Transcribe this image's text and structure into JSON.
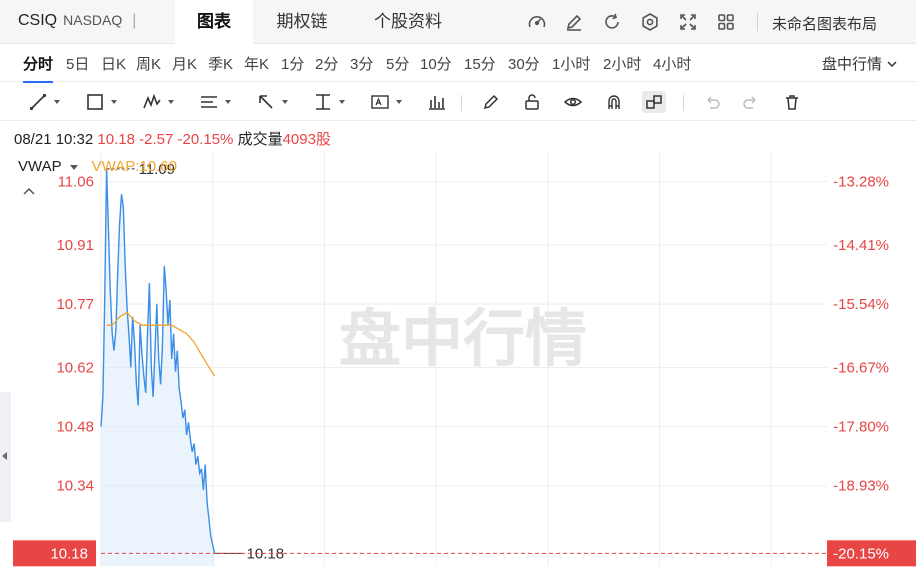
{
  "header": {
    "symbol": "CSIQ",
    "exchange": "NASDAQ",
    "separator": "|",
    "tabs": [
      {
        "label": "图表",
        "active": true
      },
      {
        "label": "期权链",
        "active": false
      },
      {
        "label": "个股资料",
        "active": false
      }
    ],
    "icons": [
      "speedometer-icon",
      "edit-icon",
      "refresh-icon",
      "settings-icon",
      "fullscreen-icon",
      "layout-grid-icon"
    ],
    "layout_name": "未命名图表布局"
  },
  "intervals": {
    "items": [
      "分时",
      "5日",
      "日K",
      "周K",
      "月K",
      "季K",
      "年K",
      "1分",
      "2分",
      "3分",
      "5分",
      "10分",
      "15分",
      "30分",
      "1小时",
      "2小时",
      "4小时"
    ],
    "active": "分时",
    "session_label": "盘中行情"
  },
  "quote": {
    "datetime": "08/21 10:32",
    "price": "10.18",
    "change": "-2.57",
    "change_pct": "-20.15%",
    "volume_label": "成交量",
    "volume": "4093股"
  },
  "indicator": {
    "name": "VWAP",
    "value_label": "VWAP:10.60"
  },
  "colors": {
    "price_line": "#3a8ee6",
    "price_fill": "#dbeafb",
    "vwap_line": "#f0a42a",
    "down_red": "#e84545",
    "grid": "#eeeeee",
    "watermark": "#e6e6e6"
  },
  "chart_data": {
    "type": "line",
    "watermark": "盘中行情",
    "ylim": [
      10.15,
      11.13
    ],
    "yticks": [
      "11.06",
      "10.91",
      "10.77",
      "10.62",
      "10.48",
      "10.34"
    ],
    "pct_ticks": [
      "-13.28%",
      "-14.41%",
      "-15.54%",
      "-16.67%",
      "-17.80%",
      "-18.93%"
    ],
    "high_label": "11.09",
    "low_label": "10.18",
    "last_price_label": "10.18",
    "last_pct_label": "-20.15%",
    "session_minutes": 390,
    "series": [
      {
        "name": "",
        "role": "price",
        "minutes": [
          0,
          1,
          2,
          3,
          4,
          5,
          6,
          7,
          8,
          9,
          10,
          11,
          12,
          13,
          14,
          15,
          16,
          17,
          18,
          19,
          20,
          21,
          22,
          23,
          24,
          25,
          26,
          27,
          28,
          29,
          30,
          31,
          32,
          33,
          34,
          35,
          36,
          37,
          38,
          39,
          40,
          41,
          42,
          43,
          44,
          45,
          46,
          47,
          48,
          49,
          50,
          51,
          52,
          53,
          54,
          55,
          56,
          57,
          58,
          59,
          60,
          61
        ],
        "values": [
          10.48,
          10.55,
          10.78,
          11.09,
          10.95,
          10.8,
          10.7,
          10.66,
          10.71,
          10.85,
          10.96,
          11.03,
          11.0,
          10.86,
          10.76,
          10.7,
          10.62,
          10.74,
          10.68,
          10.58,
          10.53,
          10.72,
          10.65,
          10.6,
          10.56,
          10.7,
          10.82,
          10.62,
          10.55,
          10.66,
          10.77,
          10.64,
          10.58,
          10.67,
          10.86,
          10.8,
          10.72,
          10.78,
          10.64,
          10.7,
          10.61,
          10.66,
          10.57,
          10.54,
          10.5,
          10.52,
          10.46,
          10.49,
          10.45,
          10.42,
          10.44,
          10.39,
          10.41,
          10.37,
          10.38,
          10.33,
          10.39,
          10.3,
          10.26,
          10.22,
          10.2,
          10.18
        ]
      },
      {
        "name": "VWAP",
        "role": "vwap",
        "minutes": [
          3,
          6,
          10,
          14,
          18,
          22,
          26,
          30,
          34,
          38,
          42,
          46,
          50,
          54,
          58,
          61
        ],
        "values": [
          10.72,
          10.72,
          10.74,
          10.75,
          10.73,
          10.72,
          10.72,
          10.72,
          10.72,
          10.72,
          10.71,
          10.7,
          10.68,
          10.65,
          10.62,
          10.6
        ]
      }
    ]
  }
}
